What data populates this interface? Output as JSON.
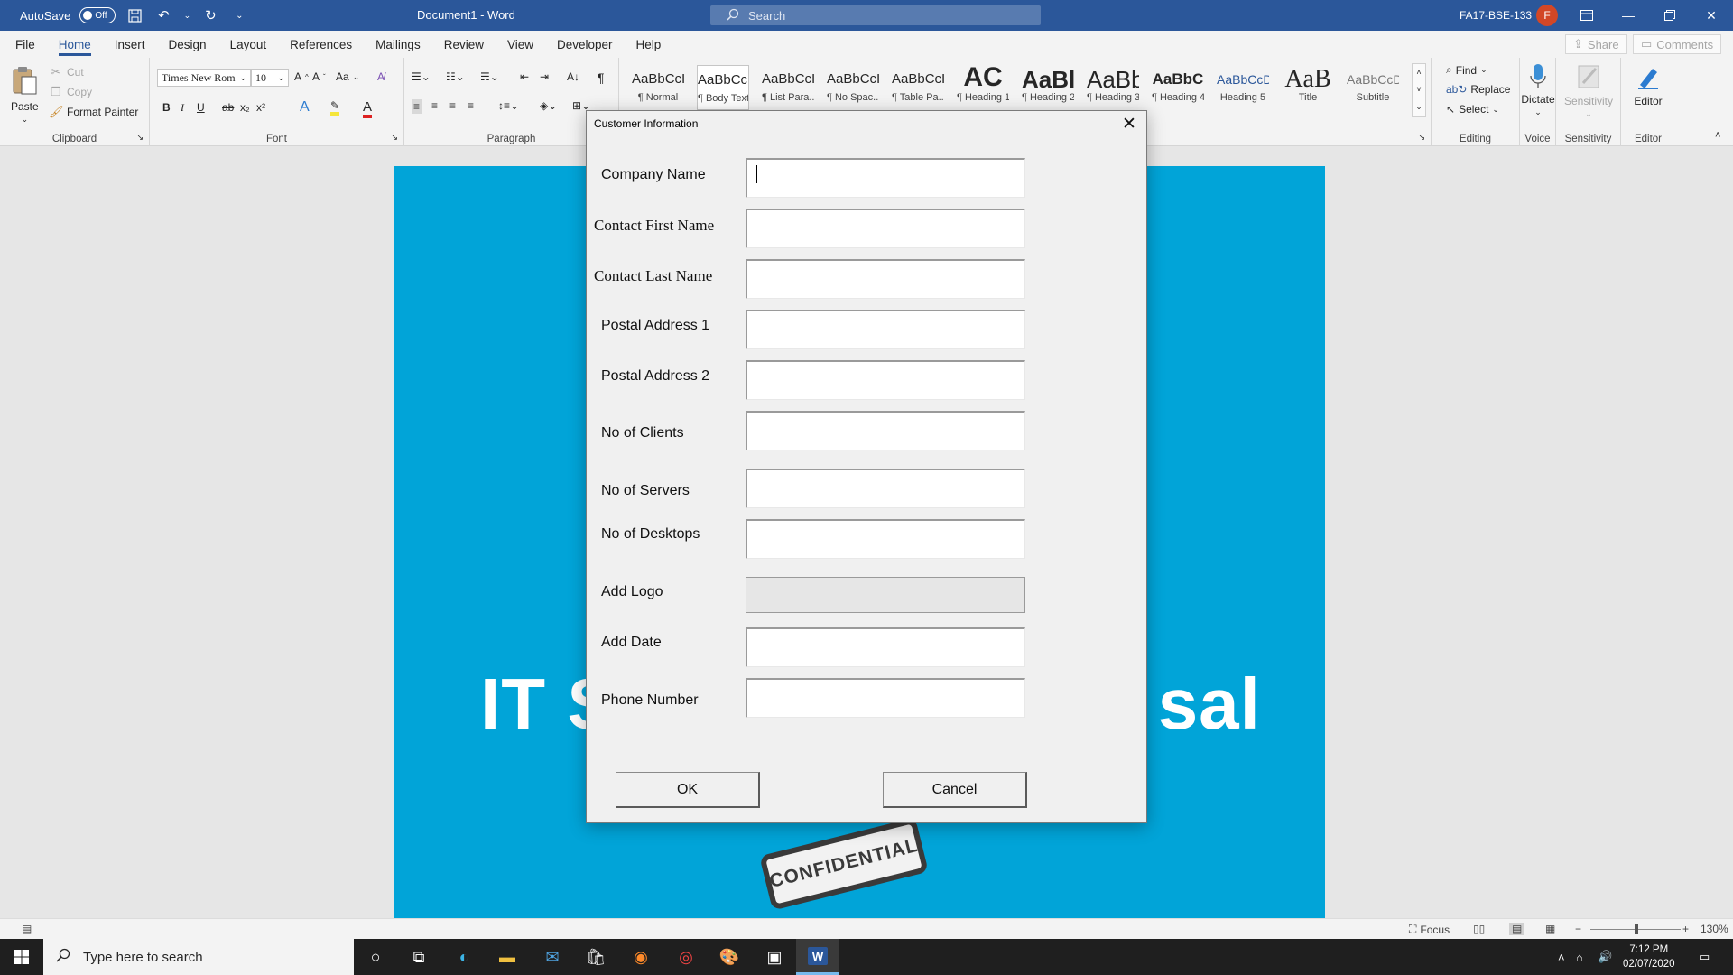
{
  "titlebar": {
    "autosave_label": "AutoSave",
    "autosave_state": "Off",
    "doc_title": "Document1  -  Word",
    "search_placeholder": "Search",
    "user_name": "FA17-BSE-133",
    "avatar_initial": "F"
  },
  "menu": {
    "items": [
      "File",
      "Home",
      "Insert",
      "Design",
      "Layout",
      "References",
      "Mailings",
      "Review",
      "View",
      "Developer",
      "Help"
    ],
    "active": "Home",
    "share_label": "Share",
    "comments_label": "Comments"
  },
  "ribbon": {
    "clipboard": {
      "paste": "Paste",
      "cut": "Cut",
      "copy": "Copy",
      "format_painter": "Format Painter",
      "label": "Clipboard"
    },
    "font": {
      "name": "Times New Rom",
      "size": "10",
      "case_btn": "Aa",
      "label": "Font"
    },
    "paragraph": {
      "label": "Paragraph"
    },
    "styles": {
      "items": [
        {
          "sample": "AaBbCcI",
          "name": "¶ Normal"
        },
        {
          "sample": "AaBbCcI",
          "name": "¶ Body Text"
        },
        {
          "sample": "AaBbCcI",
          "name": "¶ List Para..."
        },
        {
          "sample": "AaBbCcI",
          "name": "¶ No Spac..."
        },
        {
          "sample": "AaBbCcI",
          "name": "¶ Table Pa..."
        },
        {
          "sample": "AC",
          "name": "¶ Heading 1"
        },
        {
          "sample": "AaBl",
          "name": "¶ Heading 2"
        },
        {
          "sample": "AaBb",
          "name": "¶ Heading 3"
        },
        {
          "sample": "AaBbC",
          "name": "¶ Heading 4"
        },
        {
          "sample": "AaBbCcD",
          "name": "Heading 5"
        },
        {
          "sample": "AaB",
          "name": "Title"
        },
        {
          "sample": "AaBbCcD",
          "name": "Subtitle"
        }
      ]
    },
    "editing": {
      "find": "Find",
      "replace": "Replace",
      "select": "Select",
      "label": "Editing"
    },
    "voice": {
      "dictate": "Dictate",
      "label": "Voice"
    },
    "sensitivity": {
      "button": "Sensitivity",
      "label": "Sensitivity"
    },
    "editor": {
      "button": "Editor",
      "label": "Editor"
    }
  },
  "document": {
    "title_visible_left": "IT S",
    "title_visible_right": "sal",
    "stamp_text": "CONFIDENTIAL"
  },
  "dialog": {
    "title": "Customer Information",
    "fields": [
      {
        "label": "Company Name",
        "value": ""
      },
      {
        "label": "Contact First Name",
        "value": ""
      },
      {
        "label": "Contact Last Name",
        "value": ""
      },
      {
        "label": "Postal Address 1",
        "value": ""
      },
      {
        "label": "Postal Address 2",
        "value": ""
      },
      {
        "label": "No of Clients",
        "value": ""
      },
      {
        "label": "No of Servers",
        "value": ""
      },
      {
        "label": "No of Desktops",
        "value": ""
      },
      {
        "label": "Add Logo",
        "value": ""
      },
      {
        "label": "Add Date",
        "value": ""
      },
      {
        "label": "Phone Number",
        "value": ""
      }
    ],
    "ok_label": "OK",
    "cancel_label": "Cancel"
  },
  "statusbar": {
    "focus_label": "Focus",
    "zoom_level": "130%"
  },
  "taskbar": {
    "search_placeholder": "Type here to search",
    "time": "7:12 PM",
    "date": "02/07/2020"
  },
  "colors": {
    "word_blue": "#2b579a",
    "page_background": "#01a4d8",
    "dialog_background": "#f0f0f0"
  }
}
